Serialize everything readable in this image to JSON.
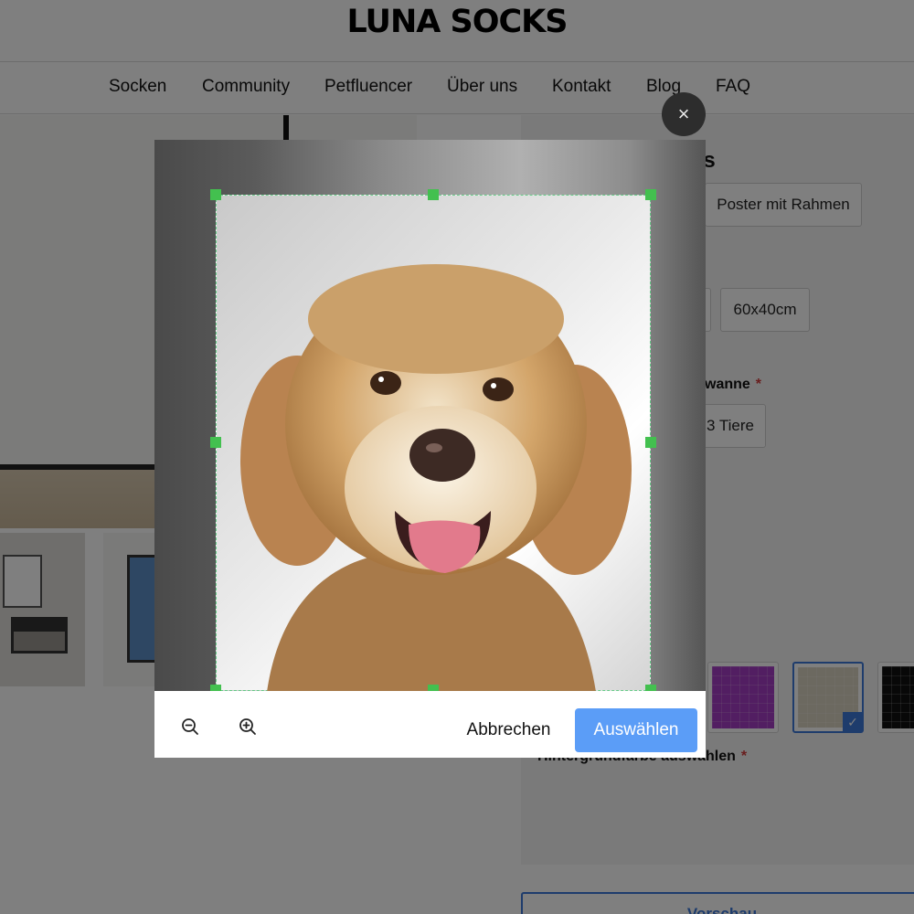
{
  "header": {
    "logo": "LUNA SOCKS"
  },
  "nav": {
    "items": [
      "Socken",
      "Community",
      "Petfluencer",
      "Über uns",
      "Kontakt",
      "Blog",
      "FAQ"
    ]
  },
  "config": {
    "heading_fragment": "rs",
    "format_options": [
      "Poster mit Rahmen"
    ],
    "size_options": [
      "60x40cm"
    ],
    "animals_label_fragment": "wanne",
    "animals_options": [
      "3 Tiere"
    ],
    "background_label": "Hintergrundfarbe auswählen",
    "required_mark": "*",
    "swatches": [
      {
        "color": "#a41c1c",
        "selected": false
      },
      {
        "color": "#3a6fc1",
        "selected": false
      },
      {
        "color": "#a43cc4",
        "selected": false
      },
      {
        "color": "#d9d2c0",
        "selected": true
      },
      {
        "color": "#111111",
        "selected": false
      }
    ],
    "preview_label": "Vorschau",
    "check_glyph": "✓"
  },
  "modal": {
    "close_glyph": "×",
    "cancel_label": "Abbrechen",
    "select_label": "Auswählen",
    "accent_color": "#5b9df7",
    "handle_color": "#43c04f"
  }
}
